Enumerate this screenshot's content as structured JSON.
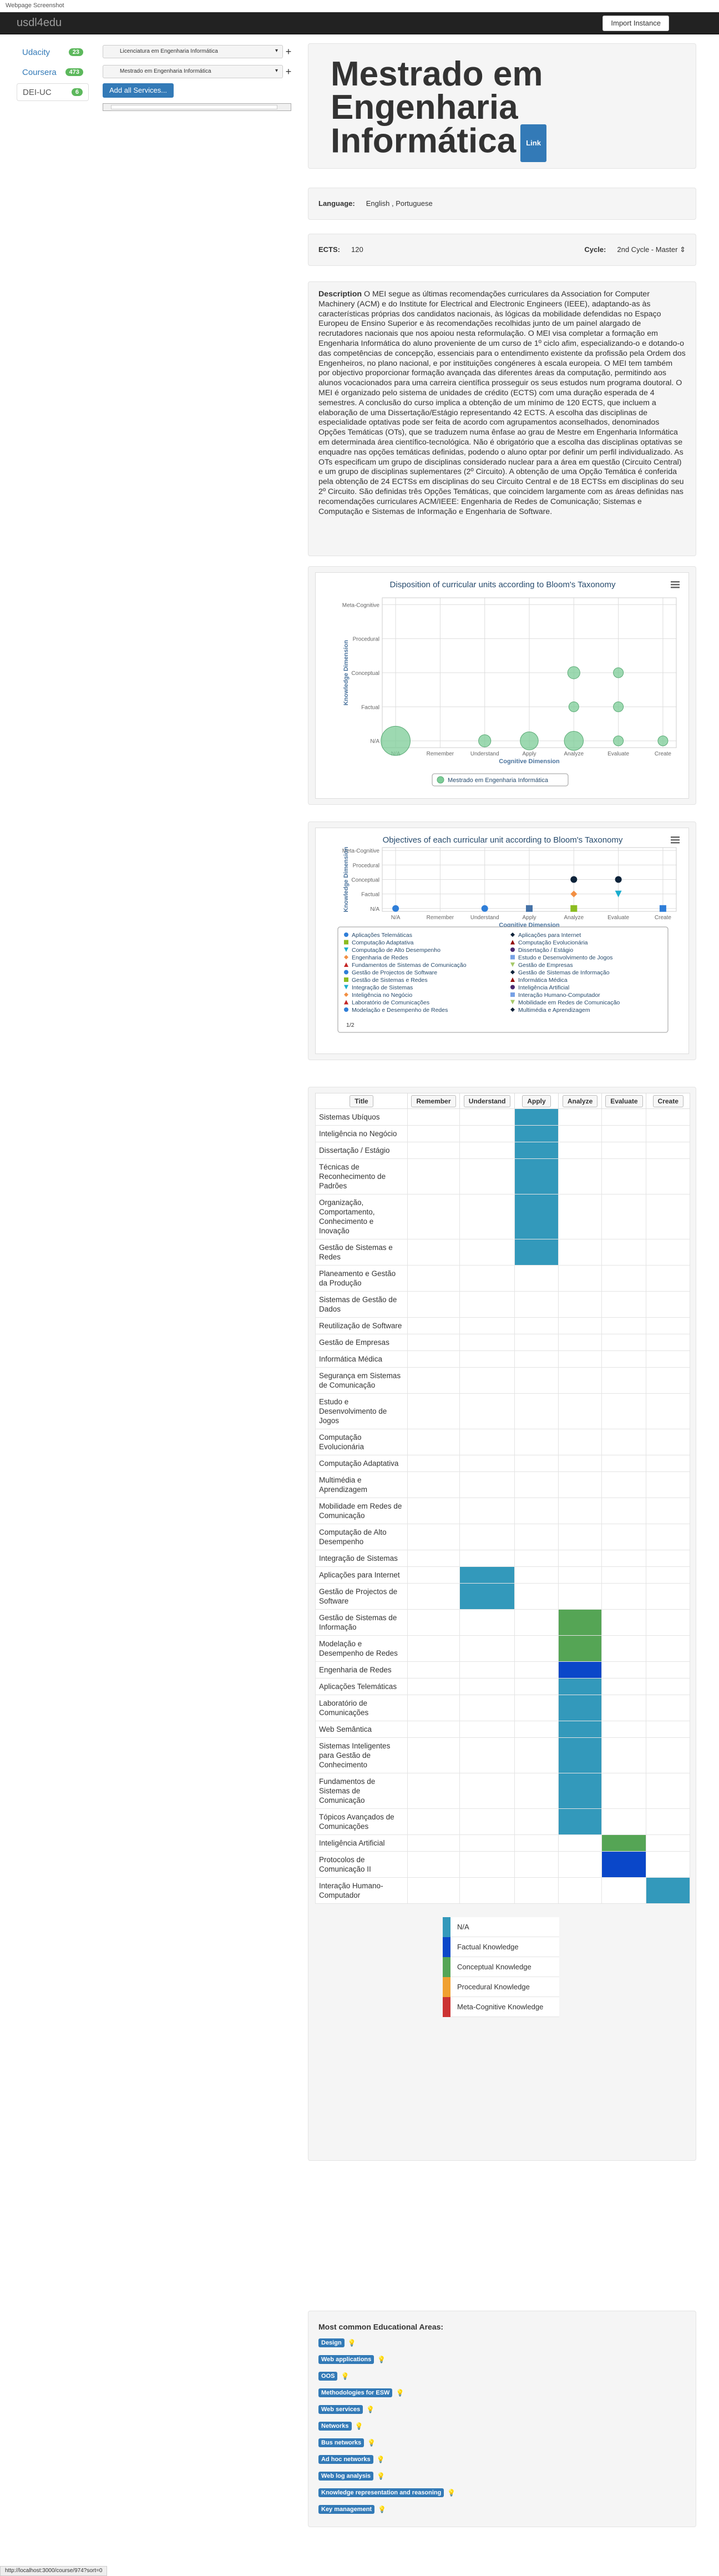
{
  "window_caption": "Webpage Screenshot",
  "navbar": {
    "brand": "usdl4edu",
    "import_label": "Import Instance"
  },
  "sources": [
    {
      "label": "Udacity",
      "count": "23",
      "active": false
    },
    {
      "label": "Coursera",
      "count": "473",
      "active": false
    },
    {
      "label": "DEI-UC",
      "count": "6",
      "active": true
    }
  ],
  "services": [
    {
      "label": "Licenciatura em Engenharia Informática",
      "plus": "+"
    },
    {
      "label": "Mestrado em Engenharia Informática",
      "plus": "+"
    }
  ],
  "add_all_label": "Add all Services...",
  "title": "Mestrado em Engenharia Informática",
  "link_label": "Link",
  "language": {
    "label": "Language:",
    "value": "English , Portuguese"
  },
  "ects": {
    "label": "ECTS:",
    "value": "120"
  },
  "cycle": {
    "label": "Cycle:",
    "value": "2nd Cycle - Master"
  },
  "description": {
    "label": "Description",
    "text": "O MEI segue as últimas recomendações curriculares da Association for Computer Machinery (ACM) e do Institute for Electrical and Electronic Engineers (IEEE), adaptando-as às características próprias dos candidatos nacionais, às lógicas da mobilidade defendidas no Espaço Europeu de Ensino Superior e às recomendações recolhidas junto de um painel alargado de recrutadores nacionais que nos apoiou nesta reformulação. O MEI visa completar a formação em Engenharia Informática do aluno proveniente de um curso de 1º ciclo afim, especializando-o e dotando-o das competências de concepção, essenciais para o entendimento existente da profissão pela Ordem dos Engenheiros, no plano nacional, e por instituições congéneres à escala europeia. O MEI tem também por objectivo proporcionar formação avançada das diferentes áreas da computação, permitindo aos alunos vocacionados para uma carreira científica prosseguir os seus estudos num programa doutoral. O MEI é organizado pelo sistema de unidades de crédito (ECTS) com uma duração esperada de 4 semestres. A conclusão do curso implica a obtenção de um mínimo de 120 ECTS, que incluem a elaboração de uma Dissertação/Estágio representando 42 ECTS. A escolha das disciplinas de especialidade optativas pode ser feita de acordo com agrupamentos aconselhados, denominados Opções Temáticas (OTs), que se traduzem numa ênfase ao grau de Mestre em Engenharia Informática em determinada área científico-tecnológica. Não é obrigatório que a escolha das disciplinas optativas se enquadre nas opções temáticas definidas, podendo o aluno optar por definir um perfil individualizado. As OTs especificam um grupo de disciplinas considerado nuclear para a área em questão (Circuito Central) e um grupo de disciplinas suplementares (2º Circuito). A obtenção de uma Opção Temática é conferida pela obtenção de 24 ECTSs em disciplinas do seu Circuito Central e de 18 ECTSs em disciplinas do seu 2º Circuito. São definidas três Opções Temáticas, que coincidem largamente com as áreas definidas nas recomendações curriculares ACM/IEEE: Engenharia de Redes de Comunicação; Sistemas e Computação e Sistemas de Informação e Engenharia de Software."
  },
  "chart_data": [
    {
      "type": "scatter",
      "title": "Disposition of curricular units according to Bloom's Taxonomy",
      "xlabel": "Cognitive Dimension",
      "ylabel": "Knowledge Dimension",
      "categories_x": [
        "N/A",
        "Remember",
        "Understand",
        "Apply",
        "Analyze",
        "Evaluate",
        "Create"
      ],
      "categories_y": [
        "N/A",
        "Factual",
        "Conceptual",
        "Procedural",
        "Meta-Cognitive"
      ],
      "series": [
        {
          "name": "Mestrado em Engenharia Informática",
          "color": "#7ccc97",
          "points": [
            {
              "x": "N/A",
              "y": "N/A",
              "size": 20
            },
            {
              "x": "Understand",
              "y": "N/A",
              "size": 2
            },
            {
              "x": "Apply",
              "y": "N/A",
              "size": 6
            },
            {
              "x": "Analyze",
              "y": "N/A",
              "size": 7
            },
            {
              "x": "Evaluate",
              "y": "N/A",
              "size": 1
            },
            {
              "x": "Create",
              "y": "N/A",
              "size": 1
            },
            {
              "x": "Analyze",
              "y": "Factual",
              "size": 1
            },
            {
              "x": "Evaluate",
              "y": "Factual",
              "size": 1
            },
            {
              "x": "Analyze",
              "y": "Conceptual",
              "size": 2
            },
            {
              "x": "Evaluate",
              "y": "Conceptual",
              "size": 1
            }
          ]
        }
      ]
    },
    {
      "type": "scatter",
      "title": "Objectives of each curricular unit according to Bloom's Taxonomy",
      "xlabel": "Cognitive Dimension",
      "ylabel": "Knowledge Dimension",
      "categories_x": [
        "N/A",
        "Remember",
        "Understand",
        "Apply",
        "Analyze",
        "Evaluate",
        "Create"
      ],
      "categories_y": [
        "N/A",
        "Factual",
        "Conceptual",
        "Procedural",
        "Meta-Cognitive"
      ],
      "points": [
        {
          "x": "N/A",
          "y": "N/A",
          "color": "#2f7ed8",
          "shape": "circle"
        },
        {
          "x": "Understand",
          "y": "N/A",
          "color": "#2f7ed8",
          "shape": "circle"
        },
        {
          "x": "Apply",
          "y": "N/A",
          "color": "#4572a7",
          "shape": "square"
        },
        {
          "x": "Analyze",
          "y": "N/A",
          "color": "#8bbc21",
          "shape": "square"
        },
        {
          "x": "Create",
          "y": "N/A",
          "color": "#2f7ed8",
          "shape": "square"
        },
        {
          "x": "Analyze",
          "y": "Factual",
          "color": "#f28f43",
          "shape": "diamond"
        },
        {
          "x": "Evaluate",
          "y": "Factual",
          "color": "#1aadce",
          "shape": "triangle-down"
        },
        {
          "x": "Analyze",
          "y": "Conceptual",
          "color": "#0d233a",
          "shape": "circle"
        },
        {
          "x": "Evaluate",
          "y": "Conceptual",
          "color": "#0d233a",
          "shape": "circle"
        }
      ],
      "legend": [
        {
          "name": "Aplicações Telemáticas",
          "color": "#2f7ed8",
          "shape": "circle"
        },
        {
          "name": "Aplicações para Internet",
          "color": "#0d233a",
          "shape": "diamond"
        },
        {
          "name": "Computação Adaptativa",
          "color": "#8bbc21",
          "shape": "square"
        },
        {
          "name": "Computação Evolucionária",
          "color": "#910000",
          "shape": "triangle"
        },
        {
          "name": "Computação de Alto Desempenho",
          "color": "#1aadce",
          "shape": "triangle-down"
        },
        {
          "name": "Dissertação / Estágio",
          "color": "#492970",
          "shape": "circle"
        },
        {
          "name": "Engenharia de Redes",
          "color": "#f28f43",
          "shape": "diamond"
        },
        {
          "name": "Estudo e Desenvolvimento de Jogos",
          "color": "#77a1e5",
          "shape": "square"
        },
        {
          "name": "Fundamentos de Sistemas de Comunicação",
          "color": "#c42525",
          "shape": "triangle"
        },
        {
          "name": "Gestão de Empresas",
          "color": "#a6c96a",
          "shape": "triangle-down"
        },
        {
          "name": "Gestão de Projectos de Software",
          "color": "#2f7ed8",
          "shape": "circle"
        },
        {
          "name": "Gestão de Sistemas de Informação",
          "color": "#0d233a",
          "shape": "diamond"
        },
        {
          "name": "Gestão de Sistemas e Redes",
          "color": "#8bbc21",
          "shape": "square"
        },
        {
          "name": "Informática Médica",
          "color": "#910000",
          "shape": "triangle"
        },
        {
          "name": "Integração de Sistemas",
          "color": "#1aadce",
          "shape": "triangle-down"
        },
        {
          "name": "Inteligência Artificial",
          "color": "#492970",
          "shape": "circle"
        },
        {
          "name": "Inteligência no Negócio",
          "color": "#f28f43",
          "shape": "diamond"
        },
        {
          "name": "Interação Humano-Computador",
          "color": "#77a1e5",
          "shape": "square"
        },
        {
          "name": "Laboratório de Comunicações",
          "color": "#c42525",
          "shape": "triangle"
        },
        {
          "name": "Mobilidade em Redes de Comunicação",
          "color": "#a6c96a",
          "shape": "triangle-down"
        },
        {
          "name": "Modelação e Desempenho de Redes",
          "color": "#2f7ed8",
          "shape": "circle"
        },
        {
          "name": "Multimédia e Aprendizagem",
          "color": "#0d233a",
          "shape": "diamond"
        }
      ],
      "legend_nav": "1/2"
    }
  ],
  "table": {
    "headers": [
      "Title",
      "Remember",
      "Understand",
      "Apply",
      "Analyze",
      "Evaluate",
      "Create"
    ],
    "rows": [
      {
        "title": "Sistemas Ubíquos",
        "cells": {
          "Apply": "N/A"
        }
      },
      {
        "title": "Inteligência no Negócio",
        "cells": {
          "Apply": "N/A"
        }
      },
      {
        "title": "Dissertação / Estágio",
        "cells": {
          "Apply": "N/A"
        }
      },
      {
        "title": "Técnicas de Reconhecimento de Padrões",
        "cells": {
          "Apply": "N/A"
        }
      },
      {
        "title": "Organização, Comportamento, Conhecimento e Inovação",
        "cells": {
          "Apply": "N/A"
        }
      },
      {
        "title": "Gestão de Sistemas e Redes",
        "cells": {
          "Apply": "N/A"
        }
      },
      {
        "title": "Planeamento e Gestão da Produção",
        "cells": {}
      },
      {
        "title": "Sistemas de Gestão de Dados",
        "cells": {}
      },
      {
        "title": "Reutilização de Software",
        "cells": {}
      },
      {
        "title": "Gestão de Empresas",
        "cells": {}
      },
      {
        "title": "Informática Médica",
        "cells": {}
      },
      {
        "title": "Segurança em Sistemas de Comunicação",
        "cells": {}
      },
      {
        "title": "Estudo e Desenvolvimento de Jogos",
        "cells": {}
      },
      {
        "title": "Computação Evolucionária",
        "cells": {}
      },
      {
        "title": "Computação Adaptativa",
        "cells": {}
      },
      {
        "title": "Multimédia e Aprendizagem",
        "cells": {}
      },
      {
        "title": "Mobilidade em Redes de Comunicação",
        "cells": {}
      },
      {
        "title": "Computação de Alto Desempenho",
        "cells": {}
      },
      {
        "title": "Integração de Sistemas",
        "cells": {}
      },
      {
        "title": "Aplicações para Internet",
        "cells": {
          "Understand": "N/A"
        }
      },
      {
        "title": "Gestão de Projectos de Software",
        "cells": {
          "Understand": "N/A"
        }
      },
      {
        "title": "Gestão de Sistemas de Informação",
        "cells": {
          "Analyze": "Conceptual Knowledge"
        }
      },
      {
        "title": "Modelação e Desempenho de Redes",
        "cells": {
          "Analyze": "Conceptual Knowledge"
        }
      },
      {
        "title": "Engenharia de Redes",
        "cells": {
          "Analyze": "Factual Knowledge"
        }
      },
      {
        "title": "Aplicações Telemáticas",
        "cells": {
          "Analyze": "N/A"
        }
      },
      {
        "title": "Laboratório de Comunicações",
        "cells": {
          "Analyze": "N/A"
        }
      },
      {
        "title": "Web Semântica",
        "cells": {
          "Analyze": "N/A"
        }
      },
      {
        "title": "Sistemas Inteligentes para Gestão de Conhecimento",
        "cells": {
          "Analyze": "N/A"
        }
      },
      {
        "title": "Fundamentos de Sistemas de Comunicação",
        "cells": {
          "Analyze": "N/A"
        }
      },
      {
        "title": "Tópicos Avançados de Comunicações",
        "cells": {
          "Analyze": "N/A"
        }
      },
      {
        "title": "Inteligência Artificial",
        "cells": {
          "Evaluate": "Conceptual Knowledge"
        }
      },
      {
        "title": "Protocolos de Comunicação II",
        "cells": {
          "Evaluate": "Factual Knowledge"
        }
      },
      {
        "title": "Interação Humano-Computador",
        "cells": {
          "Create": "N/A"
        }
      }
    ]
  },
  "knowledge_colors": [
    {
      "label": "N/A",
      "color": "#3399bb"
    },
    {
      "label": "Factual Knowledge",
      "color": "#0a47c9"
    },
    {
      "label": "Conceptual Knowledge",
      "color": "#55a555"
    },
    {
      "label": "Procedural Knowledge",
      "color": "#f0a030"
    },
    {
      "label": "Meta-Cognitive Knowledge",
      "color": "#cc3333"
    }
  ],
  "areas": {
    "title": "Most common Educational Areas:",
    "icon": "lightbulb-icon",
    "items": [
      "Design",
      "Web applications",
      "OOS",
      "Methodologies for ESW",
      "Web services",
      "Networks",
      "Bus networks",
      "Ad hoc networks",
      "Web log analysis",
      "Knowledge representation and reasoning",
      "Key management"
    ]
  },
  "status_url": "http://localhost:3000/course/974?sort=0"
}
